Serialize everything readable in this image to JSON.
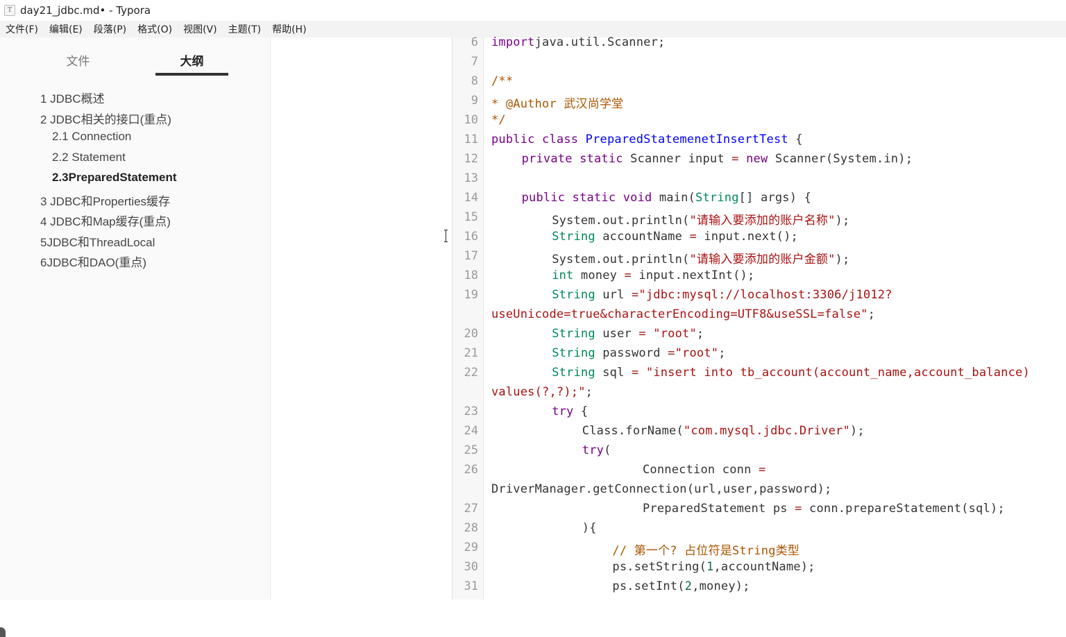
{
  "window": {
    "title": "day21_jdbc.md• - Typora",
    "app_icon": "T"
  },
  "menu": [
    "文件(F)",
    "编辑(E)",
    "段落(P)",
    "格式(O)",
    "视图(V)",
    "主题(T)",
    "帮助(H)"
  ],
  "sidebar": {
    "tabs": [
      "文件",
      "大纲"
    ],
    "active_tab": "大纲",
    "outline": [
      {
        "label": "1 JDBC概述",
        "level": 1
      },
      {
        "label": "2 JDBC相关的接口(重点)",
        "level": 1
      },
      {
        "label": "2.1 Connection",
        "level": 2
      },
      {
        "label": "2.2 Statement",
        "level": 2
      },
      {
        "label": "2.3PreparedStatement",
        "level": 2,
        "active": true
      },
      {
        "label": "3 JDBC和Properties缓存",
        "level": 1
      },
      {
        "label": "4 JDBC和Map缓存(重点)",
        "level": 1
      },
      {
        "label": "5JDBC和ThreadLocal",
        "level": 1
      },
      {
        "label": "6JDBC和DAO(重点)",
        "level": 1
      }
    ]
  },
  "code": {
    "lines": [
      {
        "n": "6",
        "segs": [
          [
            "kw",
            "import"
          ],
          [
            "",
            "java.util.Scanner;"
          ]
        ]
      },
      {
        "n": "7",
        "segs": []
      },
      {
        "n": "8",
        "segs": [
          [
            "cm",
            "/**"
          ]
        ]
      },
      {
        "n": "9",
        "segs": [
          [
            "cm",
            " * @Author 武汉尚学堂"
          ]
        ]
      },
      {
        "n": "10",
        "segs": [
          [
            "cm",
            " */"
          ]
        ]
      },
      {
        "n": "11",
        "segs": [
          [
            "kw",
            "public"
          ],
          [
            "",
            " "
          ],
          [
            "kw",
            "class"
          ],
          [
            "",
            " "
          ],
          [
            "def",
            "PreparedStatemenetInsertTest"
          ],
          [
            "",
            " {"
          ]
        ]
      },
      {
        "n": "12",
        "segs": [
          [
            "",
            " "
          ],
          [
            "kw",
            "private"
          ],
          [
            "",
            " "
          ],
          [
            "kw",
            "static"
          ],
          [
            "",
            " Scanner input "
          ],
          [
            "op",
            "="
          ],
          [
            "",
            " "
          ],
          [
            "kw",
            "new"
          ],
          [
            "",
            " Scanner(System.in);"
          ]
        ]
      },
      {
        "n": "13",
        "segs": []
      },
      {
        "n": "14",
        "segs": [
          [
            "",
            " "
          ],
          [
            "kw",
            "public"
          ],
          [
            "",
            " "
          ],
          [
            "kw",
            "static"
          ],
          [
            "",
            " "
          ],
          [
            "kw",
            "void"
          ],
          [
            "",
            " main("
          ],
          [
            "ty",
            "String"
          ],
          [
            "",
            "[] args) {"
          ]
        ]
      },
      {
        "n": "15",
        "segs": [
          [
            "",
            " System.out.println("
          ],
          [
            "str",
            "\"请输入要添加的账户名称\""
          ],
          [
            "",
            ");"
          ]
        ]
      },
      {
        "n": "16",
        "segs": [
          [
            "",
            " "
          ],
          [
            "ty",
            "String"
          ],
          [
            "",
            " accountName "
          ],
          [
            "op",
            "="
          ],
          [
            "",
            " input.next();"
          ]
        ]
      },
      {
        "n": "17",
        "segs": [
          [
            "",
            " System.out.println("
          ],
          [
            "str",
            "\"请输入要添加的账户金额\""
          ],
          [
            "",
            ");"
          ]
        ]
      },
      {
        "n": "18",
        "segs": [
          [
            "",
            " "
          ],
          [
            "ty",
            "int"
          ],
          [
            "",
            " money "
          ],
          [
            "op",
            "="
          ],
          [
            "",
            " input.nextInt();"
          ]
        ]
      },
      {
        "n": "19",
        "segs": [
          [
            "",
            " "
          ],
          [
            "ty",
            "String"
          ],
          [
            "",
            " url "
          ],
          [
            "op",
            "="
          ],
          [
            "str",
            "\"jdbc:mysql://localhost:3306/j1012?"
          ]
        ]
      },
      {
        "n": "",
        "segs": [
          [
            "str",
            "useUnicode=true&characterEncoding=UTF8&useSSL=false\""
          ],
          [
            "",
            ";"
          ]
        ]
      },
      {
        "n": "20",
        "segs": [
          [
            "",
            " "
          ],
          [
            "ty",
            "String"
          ],
          [
            "",
            " user "
          ],
          [
            "op",
            "="
          ],
          [
            "",
            " "
          ],
          [
            "str",
            "\"root\""
          ],
          [
            "",
            ";"
          ]
        ]
      },
      {
        "n": "21",
        "segs": [
          [
            "",
            " "
          ],
          [
            "ty",
            "String"
          ],
          [
            "",
            " password "
          ],
          [
            "op",
            "="
          ],
          [
            "str",
            "\"root\""
          ],
          [
            "",
            ";"
          ]
        ]
      },
      {
        "n": "22",
        "segs": [
          [
            "",
            " "
          ],
          [
            "ty",
            "String"
          ],
          [
            "",
            " sql "
          ],
          [
            "op",
            "="
          ],
          [
            "",
            " "
          ],
          [
            "str",
            "\"insert into tb_account(account_name,account_balance)"
          ]
        ]
      },
      {
        "n": "",
        "segs": [
          [
            "str",
            "values(?,?);\""
          ],
          [
            "",
            ";"
          ]
        ]
      },
      {
        "n": "23",
        "segs": [
          [
            "",
            " "
          ],
          [
            "kw",
            "try"
          ],
          [
            "",
            " {"
          ]
        ]
      },
      {
        "n": "24",
        "segs": [
          [
            "",
            " Class.forName("
          ],
          [
            "str",
            "\"com.mysql.jdbc.Driver\""
          ],
          [
            "",
            ");"
          ]
        ]
      },
      {
        "n": "25",
        "segs": [
          [
            "",
            " "
          ],
          [
            "kw",
            "try"
          ],
          [
            "",
            "("
          ]
        ]
      },
      {
        "n": "26",
        "segs": [
          [
            "",
            " Connection conn "
          ],
          [
            "op",
            "="
          ]
        ]
      },
      {
        "n": "",
        "segs": [
          [
            "",
            "DriverManager.getConnection(url,user,password);"
          ]
        ]
      },
      {
        "n": "27",
        "segs": [
          [
            "",
            " PreparedStatement ps "
          ],
          [
            "op",
            "="
          ],
          [
            "",
            " conn.prepareStatement(sql);"
          ]
        ]
      },
      {
        "n": "28",
        "segs": [
          [
            "",
            " ){"
          ]
        ]
      },
      {
        "n": "29",
        "segs": [
          [
            "",
            ""
          ],
          [
            "cm",
            "// 第一个? 占位符是String类型"
          ]
        ]
      },
      {
        "n": "30",
        "segs": [
          [
            "",
            " ps.setString("
          ],
          [
            "num",
            "1"
          ],
          [
            "",
            ",accountName);"
          ]
        ]
      },
      {
        "n": "31",
        "segs": [
          [
            "",
            " ps.setInt("
          ],
          [
            "num",
            "2"
          ],
          [
            "",
            ",money);"
          ]
        ]
      }
    ],
    "indents": [
      0,
      0,
      0,
      0,
      0,
      0,
      4,
      0,
      4,
      8,
      8,
      8,
      8,
      8,
      0,
      8,
      8,
      8,
      0,
      8,
      12,
      12,
      20,
      0,
      20,
      12,
      16,
      16,
      16
    ]
  }
}
